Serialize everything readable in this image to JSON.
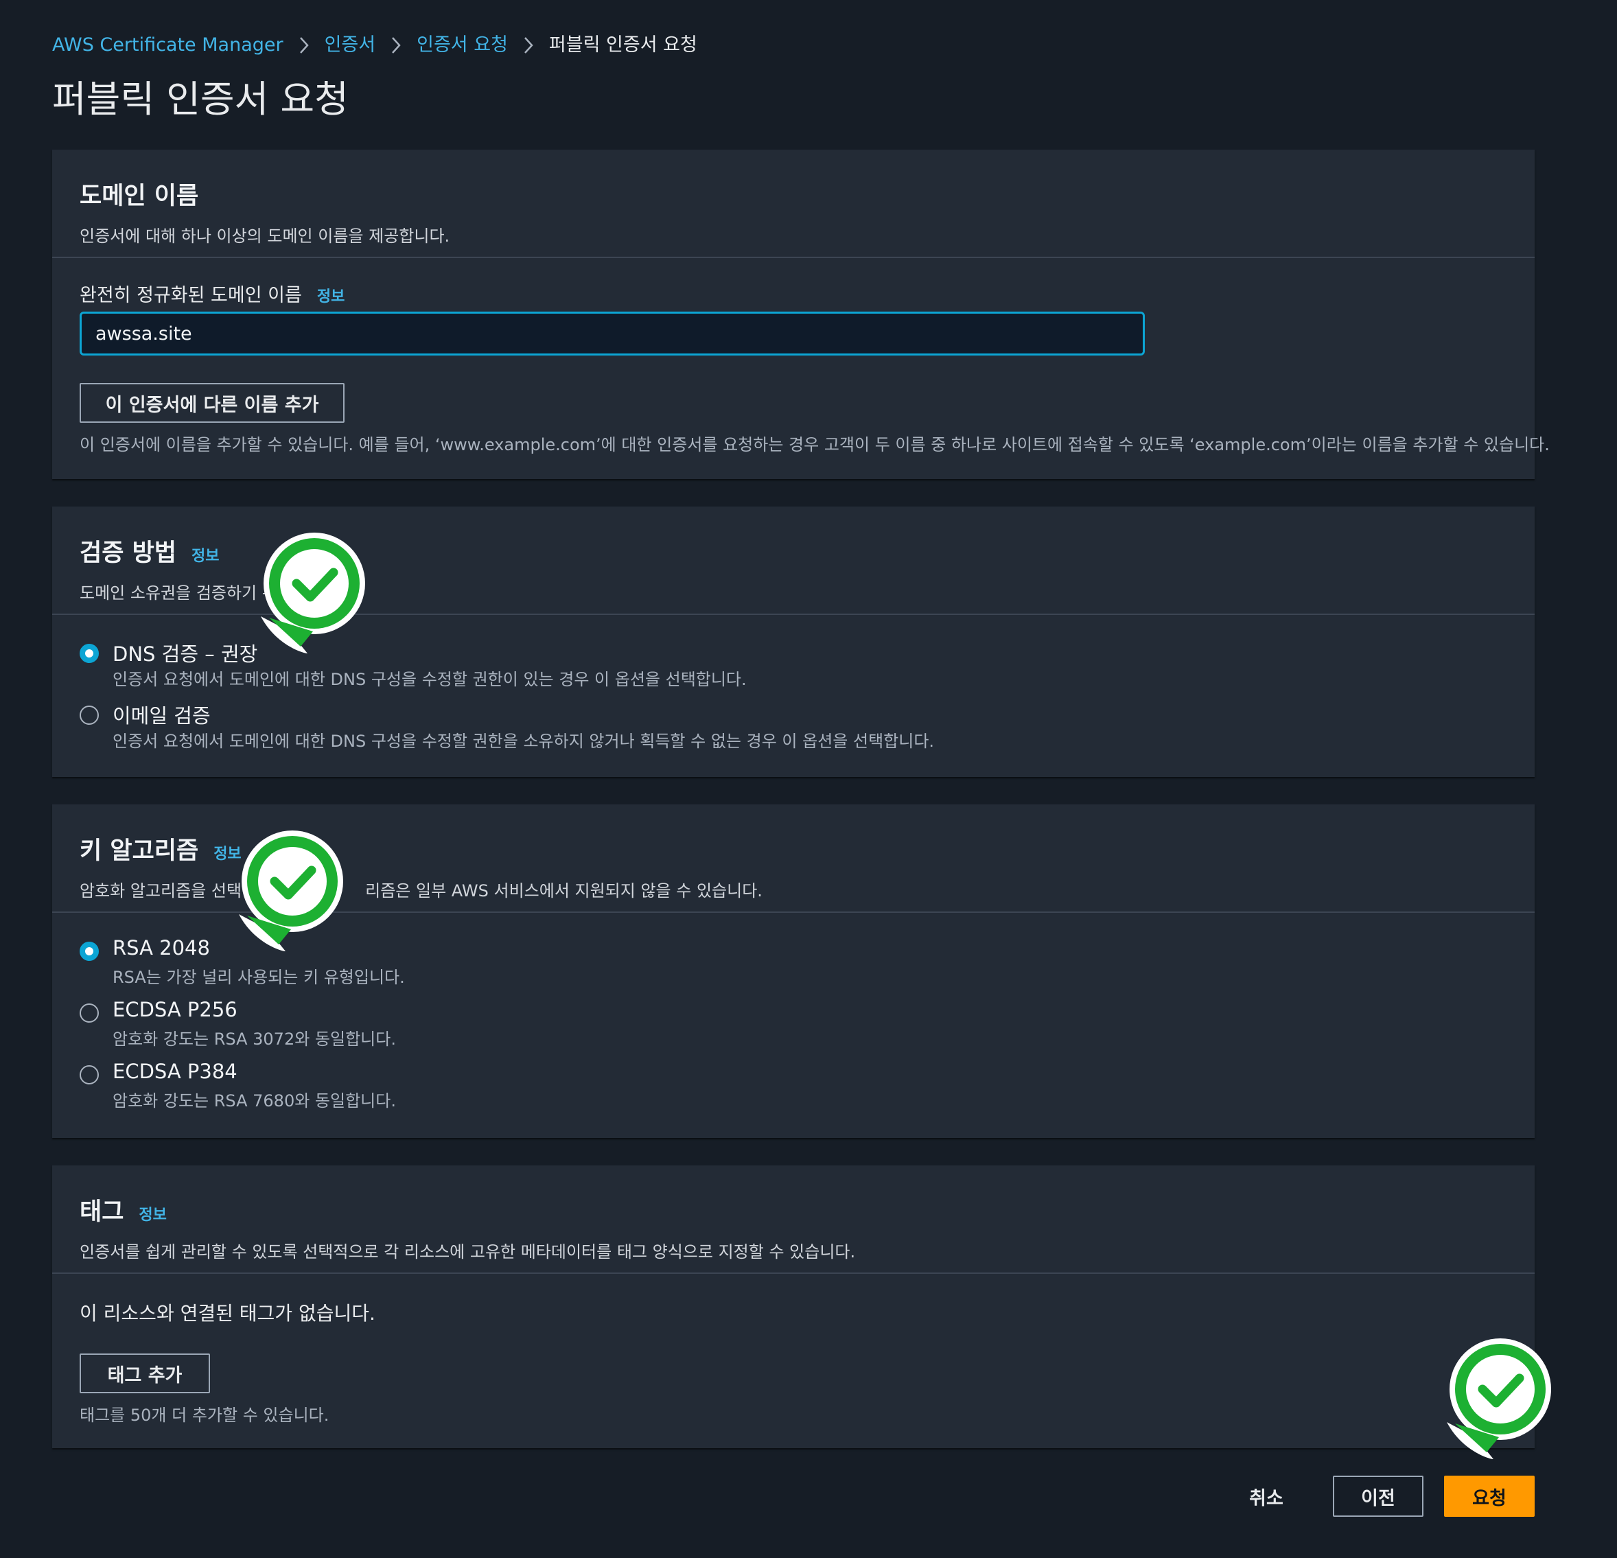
{
  "breadcrumb": {
    "items": [
      "AWS Certificate Manager",
      "인증서",
      "인증서 요청"
    ],
    "current": "퍼블릭 인증서 요청"
  },
  "page": {
    "title": "퍼블릭 인증서 요청"
  },
  "domain_panel": {
    "title": "도메인 이름",
    "description": "인증서에 대해 하나 이상의 도메인 이름을 제공합니다.",
    "field_label": "완전히 정규화된 도메인 이름",
    "info": "정보",
    "field_value": "awssa.site",
    "add_name_button": "이 인증서에 다른 이름 추가",
    "help": "이 인증서에 이름을 추가할 수 있습니다. 예를 들어, ‘www.example.com’에 대한 인증서를 요청하는 경우 고객이 두 이름 중 하나로 사이트에 접속할 수 있도록 ‘example.com’이라는 이름을 추가할 수 있습니다."
  },
  "validation_panel": {
    "title": "검증 방법",
    "info": "정보",
    "description": "도메인 소유권을 검증하기 위",
    "options": [
      {
        "label": "DNS 검증 – 권장",
        "description": "인증서 요청에서 도메인에 대한 DNS 구성을 수정할 권한이 있는 경우 이 옵션을 선택합니다.",
        "selected": true
      },
      {
        "label": "이메일 검증",
        "description": "인증서 요청에서 도메인에 대한 DNS 구성을 수정할 권한을 소유하지 않거나 획득할 수 없는 경우 이 옵션을 선택합니다.",
        "selected": false
      }
    ]
  },
  "key_panel": {
    "title": "키 알고리즘",
    "info": "정보",
    "description_left": "암호화 알고리즘을 선택합",
    "description_right": "리즘은 일부 AWS 서비스에서 지원되지 않을 수 있습니다.",
    "options": [
      {
        "label": "RSA 2048",
        "description": "RSA는 가장 널리 사용되는 키 유형입니다.",
        "selected": true
      },
      {
        "label": "ECDSA P256",
        "description": "암호화 강도는 RSA 3072와 동일합니다.",
        "selected": false
      },
      {
        "label": "ECDSA P384",
        "description": "암호화 강도는 RSA 7680와 동일합니다.",
        "selected": false
      }
    ]
  },
  "tags_panel": {
    "title": "태그",
    "info": "정보",
    "description": "인증서를 쉽게 관리할 수 있도록 선택적으로 각 리소스에 고유한 메타데이터를 태그 양식으로 지정할 수 있습니다.",
    "empty": "이 리소스와 연결된 태그가 없습니다.",
    "add_button": "태그 추가",
    "help": "태그를 50개 더 추가할 수 있습니다."
  },
  "footer": {
    "cancel": "취소",
    "previous": "이전",
    "request": "요청"
  },
  "colors": {
    "accent": "#0ca5d4",
    "link": "#42b4e6",
    "primary": "#ff9900",
    "marker": "#1db032"
  },
  "icons": {
    "breadcrumb_separator": "chevron-right-icon",
    "marker": "check-marker-icon"
  }
}
